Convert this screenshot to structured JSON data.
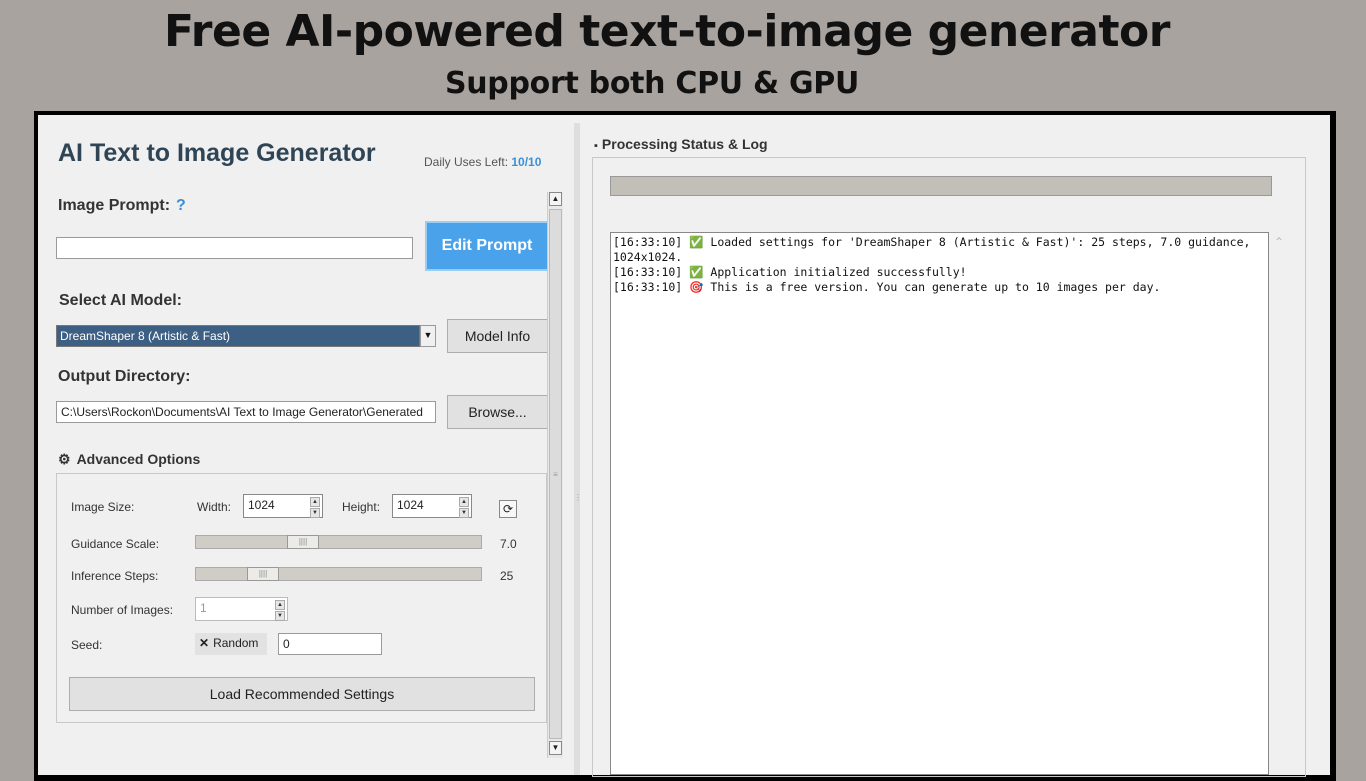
{
  "banner": {
    "title": "Free AI-powered text-to-image generator",
    "subtitle": "Support both CPU & GPU"
  },
  "app": {
    "title": "AI Text to Image Generator",
    "daily_label": "Daily Uses Left:",
    "daily_value": "10/10"
  },
  "prompt": {
    "label": "Image Prompt:",
    "help": "?",
    "value": "",
    "edit_button": "Edit Prompt"
  },
  "model": {
    "label": "Select AI Model:",
    "selected": "DreamShaper 8 (Artistic & Fast)",
    "info_button": "Model Info"
  },
  "output": {
    "label": "Output Directory:",
    "path": "C:\\Users\\Rockon\\Documents\\AI Text to Image Generator\\Generated",
    "browse_button": "Browse..."
  },
  "advanced": {
    "title": "Advanced Options",
    "image_size_label": "Image Size:",
    "width_label": "Width:",
    "width_value": "1024",
    "height_label": "Height:",
    "height_value": "1024",
    "guidance_label": "Guidance Scale:",
    "guidance_value": "7.0",
    "guidance_fraction": 0.36,
    "steps_label": "Inference Steps:",
    "steps_value": "25",
    "steps_fraction": 0.2,
    "num_images_label": "Number of Images:",
    "num_images_value": "1",
    "seed_label": "Seed:",
    "random_label": "Random",
    "seed_value": "0",
    "load_button": "Load Recommended Settings"
  },
  "status": {
    "title": "Processing Status & Log",
    "progress": 0,
    "log": [
      "[16:33:10] ✅ Loaded settings for 'DreamShaper 8 (Artistic & Fast)': 25 steps, 7.0 guidance, 1024x1024.",
      "[16:33:10] ✅ Application initialized successfully!",
      "[16:33:10] 🎯 This is a free version. You can generate up to 10 images per day."
    ]
  }
}
